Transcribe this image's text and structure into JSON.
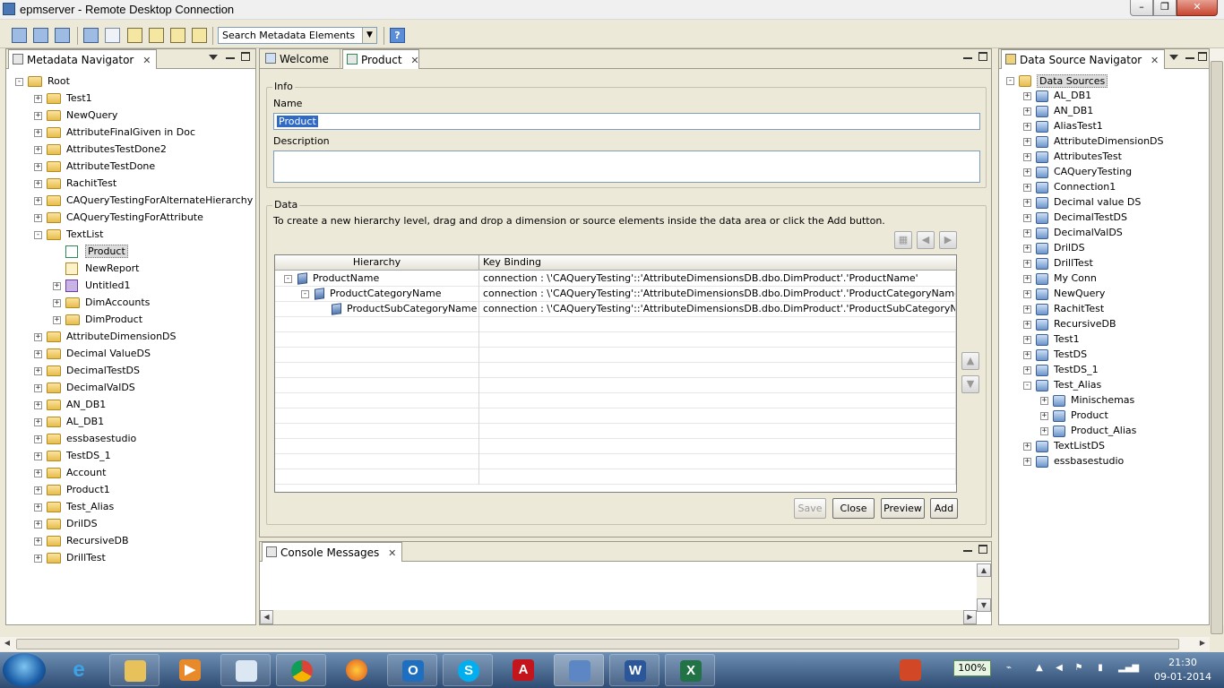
{
  "window": {
    "title": "epmserver - Remote Desktop Connection"
  },
  "toolbar": {
    "search_placeholder": "Search Metadata Elements",
    "help_label": "?"
  },
  "metadata_navigator": {
    "title": "Metadata Navigator",
    "root": "Root",
    "items": [
      {
        "label": "Test1",
        "depth": 1,
        "exp": "+"
      },
      {
        "label": "NewQuery",
        "depth": 1,
        "exp": "+"
      },
      {
        "label": "AttributeFinalGiven in Doc",
        "depth": 1,
        "exp": "+"
      },
      {
        "label": "AttributesTestDone2",
        "depth": 1,
        "exp": "+"
      },
      {
        "label": "AttributeTestDone",
        "depth": 1,
        "exp": "+"
      },
      {
        "label": "RachitTest",
        "depth": 1,
        "exp": "+"
      },
      {
        "label": "CAQueryTestingForAlternateHierarchy",
        "depth": 1,
        "exp": "+"
      },
      {
        "label": "CAQueryTestingForAttribute",
        "depth": 1,
        "exp": "+"
      },
      {
        "label": "TextList",
        "depth": 1,
        "exp": "-"
      },
      {
        "label": "Product",
        "depth": 2,
        "exp": "",
        "icon": "hierarchy-icon",
        "selected": true
      },
      {
        "label": "NewReport",
        "depth": 2,
        "exp": "",
        "icon": "report-icon"
      },
      {
        "label": "Untitled1",
        "depth": 2,
        "exp": "+",
        "icon": "cube-icon"
      },
      {
        "label": "DimAccounts",
        "depth": 2,
        "exp": "+"
      },
      {
        "label": "DimProduct",
        "depth": 2,
        "exp": "+"
      },
      {
        "label": "AttributeDimensionDS",
        "depth": 1,
        "exp": "+"
      },
      {
        "label": "Decimal ValueDS",
        "depth": 1,
        "exp": "+"
      },
      {
        "label": "DecimalTestDS",
        "depth": 1,
        "exp": "+"
      },
      {
        "label": "DecimalValDS",
        "depth": 1,
        "exp": "+"
      },
      {
        "label": "AN_DB1",
        "depth": 1,
        "exp": "+"
      },
      {
        "label": "AL_DB1",
        "depth": 1,
        "exp": "+"
      },
      {
        "label": "essbasestudio",
        "depth": 1,
        "exp": "+"
      },
      {
        "label": "TestDS_1",
        "depth": 1,
        "exp": "+"
      },
      {
        "label": "Account",
        "depth": 1,
        "exp": "+"
      },
      {
        "label": "Product1",
        "depth": 1,
        "exp": "+"
      },
      {
        "label": "Test_Alias",
        "depth": 1,
        "exp": "+"
      },
      {
        "label": "DrilDS",
        "depth": 1,
        "exp": "+"
      },
      {
        "label": "RecursiveDB",
        "depth": 1,
        "exp": "+"
      },
      {
        "label": "DrillTest",
        "depth": 1,
        "exp": "+"
      }
    ]
  },
  "editor": {
    "tabs": [
      {
        "label": "Welcome"
      },
      {
        "label": "Product"
      }
    ],
    "info_label": "Info",
    "name_label": "Name",
    "name_value": "Product",
    "description_label": "Description",
    "data_label": "Data",
    "data_help": "To create a new hierarchy level, drag and drop a dimension or source elements inside the data area or click the Add button.",
    "columns": [
      "Hierarchy",
      "Key Binding"
    ],
    "rows": [
      {
        "hierarchy": "ProductName",
        "binding": "connection : \\'CAQueryTesting'::'AttributeDimensionsDB.dbo.DimProduct'.'ProductName'"
      },
      {
        "hierarchy": "ProductCategoryName",
        "binding": "connection : \\'CAQueryTesting'::'AttributeDimensionsDB.dbo.DimProduct'.'ProductCategoryName'"
      },
      {
        "hierarchy": "ProductSubCategoryName",
        "binding": "connection : \\'CAQueryTesting'::'AttributeDimensionsDB.dbo.DimProduct'.'ProductSubCategoryName'"
      }
    ],
    "buttons": {
      "save": "Save",
      "close": "Close",
      "preview": "Preview",
      "add": "Add"
    }
  },
  "console": {
    "title": "Console Messages"
  },
  "data_source_navigator": {
    "title": "Data Source Navigator",
    "root": "Data Sources",
    "items": [
      {
        "label": "AL_DB1",
        "depth": 1
      },
      {
        "label": "AN_DB1",
        "depth": 1
      },
      {
        "label": "AliasTest1",
        "depth": 1
      },
      {
        "label": "AttributeDimensionDS",
        "depth": 1
      },
      {
        "label": "AttributesTest",
        "depth": 1
      },
      {
        "label": "CAQueryTesting",
        "depth": 1
      },
      {
        "label": "Connection1",
        "depth": 1
      },
      {
        "label": "Decimal value DS",
        "depth": 1
      },
      {
        "label": "DecimalTestDS",
        "depth": 1
      },
      {
        "label": "DecimalValDS",
        "depth": 1
      },
      {
        "label": "DrilDS",
        "depth": 1
      },
      {
        "label": "DrillTest",
        "depth": 1
      },
      {
        "label": "My Conn",
        "depth": 1
      },
      {
        "label": "NewQuery",
        "depth": 1
      },
      {
        "label": "RachitTest",
        "depth": 1
      },
      {
        "label": "RecursiveDB",
        "depth": 1
      },
      {
        "label": "Test1",
        "depth": 1
      },
      {
        "label": "TestDS",
        "depth": 1
      },
      {
        "label": "TestDS_1",
        "depth": 1
      },
      {
        "label": "Test_Alias",
        "depth": 1,
        "exp": "-"
      },
      {
        "label": "Minischemas",
        "depth": 2
      },
      {
        "label": "Product",
        "depth": 2
      },
      {
        "label": "Product_Alias",
        "depth": 2
      },
      {
        "label": "TextListDS",
        "depth": 1
      },
      {
        "label": "essbasestudio",
        "depth": 1
      }
    ]
  },
  "taskbar": {
    "battery": "100%",
    "time": "21:30",
    "date": "09-01-2014",
    "apps": [
      "explorer",
      "internet-explorer",
      "file-explorer",
      "media-player",
      "paint",
      "chrome",
      "firefox",
      "outlook",
      "skype",
      "acrobat",
      "remote-desktop",
      "word",
      "excel"
    ]
  }
}
